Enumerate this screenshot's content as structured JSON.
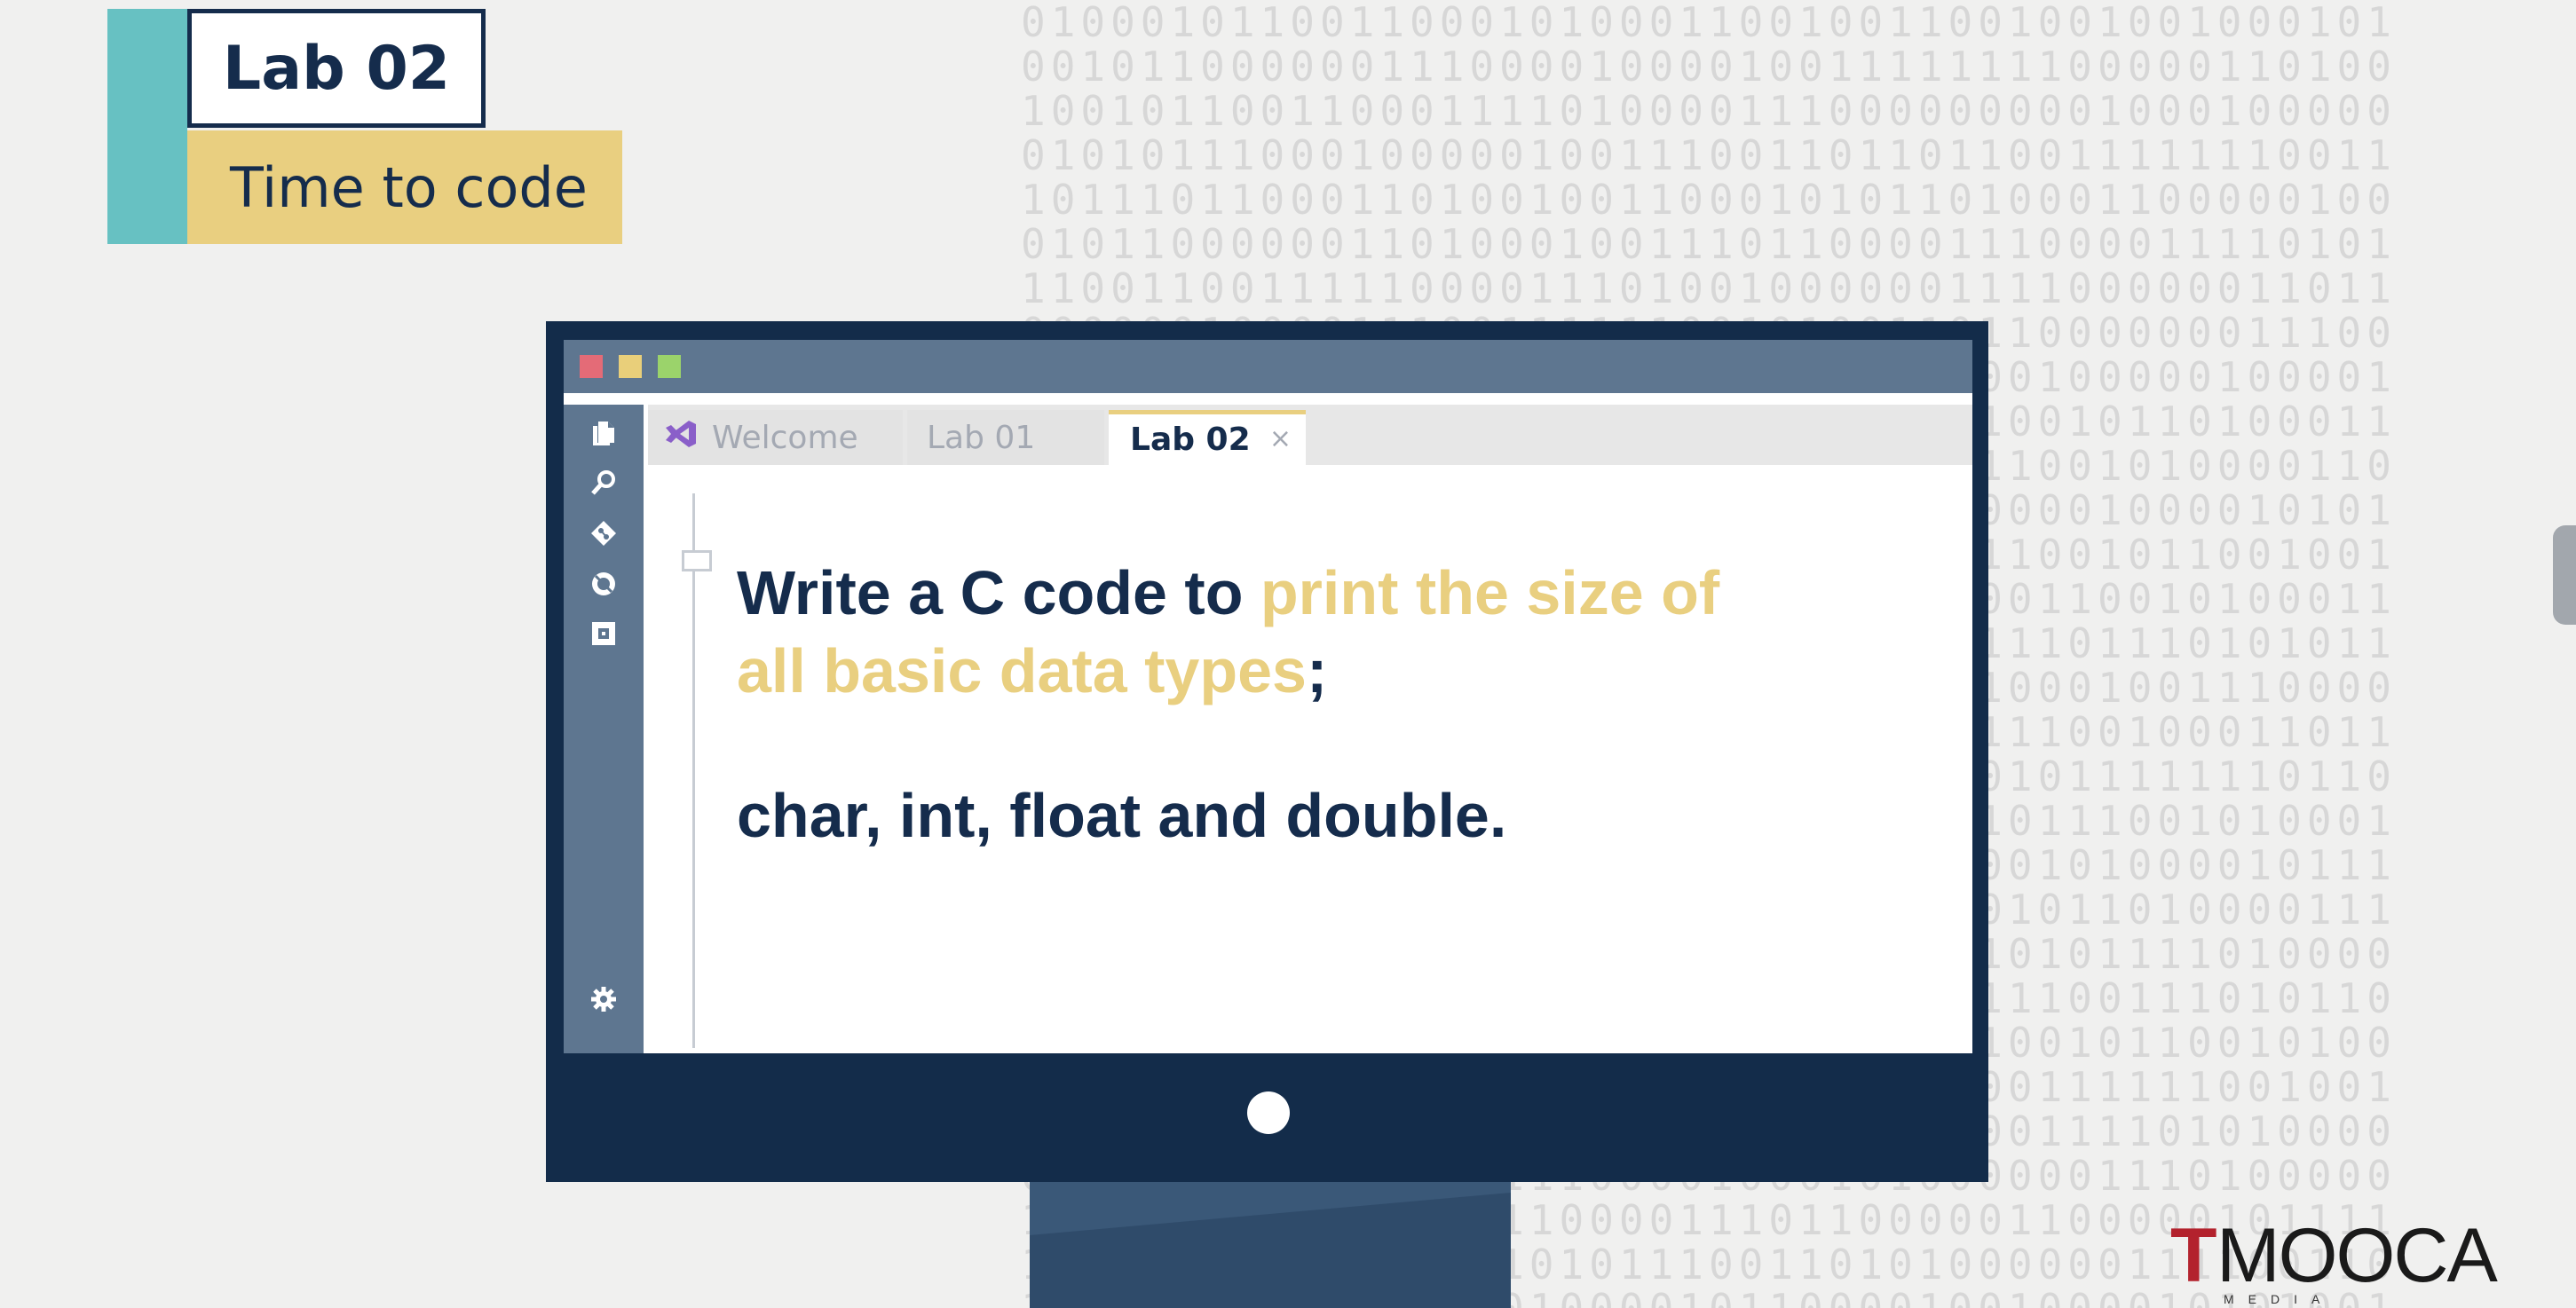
{
  "title_block": {
    "lab_label": "Lab 02",
    "subtitle": "Time to code"
  },
  "editor": {
    "tabs": [
      {
        "label": "Welcome",
        "icon": "visual-studio-icon"
      },
      {
        "label": "Lab 01"
      },
      {
        "label": "Lab 02",
        "active": true,
        "close": "×"
      }
    ],
    "activity_icons": [
      "files-icon",
      "search-icon",
      "source-control-icon",
      "debug-icon",
      "extensions-icon",
      "settings-icon"
    ],
    "content": {
      "line1_prefix": "Write a C code to ",
      "line1_highlight": "print the size of",
      "line2_highlight": "all basic data types",
      "line2_suffix": ";",
      "line3": "char, int, float and double."
    }
  },
  "logo": {
    "mark": "T",
    "name": "MOOCA",
    "tagline": "MEDIA PRODUCTION"
  },
  "colors": {
    "navy": "#152c4c",
    "teal": "#67c1c2",
    "gold": "#e9cf80",
    "slate": "#5e7690",
    "brand_red": "#b3222d"
  }
}
